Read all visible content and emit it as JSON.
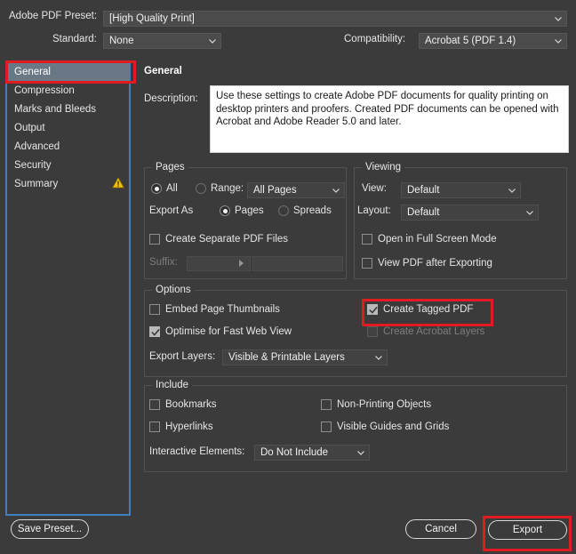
{
  "header": {
    "preset_label": "Adobe PDF Preset:",
    "preset_value": "[High Quality Print]",
    "standard_label": "Standard:",
    "standard_value": "None",
    "compatibility_label": "Compatibility:",
    "compatibility_value": "Acrobat 5 (PDF 1.4)"
  },
  "sidebar": {
    "items": [
      {
        "label": "General"
      },
      {
        "label": "Compression"
      },
      {
        "label": "Marks and Bleeds"
      },
      {
        "label": "Output"
      },
      {
        "label": "Advanced"
      },
      {
        "label": "Security"
      },
      {
        "label": "Summary"
      }
    ]
  },
  "main": {
    "title": "General",
    "description_label": "Description:",
    "description_value": "Use these settings to create Adobe PDF documents for quality printing on desktop printers and proofers.  Created PDF documents can be opened with Acrobat and Adobe Reader 5.0 and later.",
    "pages": {
      "legend": "Pages",
      "all_label": "All",
      "range_label": "Range:",
      "range_value": "All Pages",
      "export_as_label": "Export As",
      "pages_label": "Pages",
      "spreads_label": "Spreads",
      "create_separate_label": "Create Separate PDF Files",
      "suffix_label": "Suffix:"
    },
    "viewing": {
      "legend": "Viewing",
      "view_label": "View:",
      "view_value": "Default",
      "layout_label": "Layout:",
      "layout_value": "Default",
      "full_screen_label": "Open in Full Screen Mode",
      "view_pdf_label": "View PDF after Exporting"
    },
    "options": {
      "legend": "Options",
      "embed_thumbs_label": "Embed Page Thumbnails",
      "optimise_label": "Optimise for Fast Web View",
      "tagged_pdf_label": "Create Tagged PDF",
      "acrobat_layers_label": "Create Acrobat Layers",
      "export_layers_label": "Export Layers:",
      "export_layers_value": "Visible & Printable Layers"
    },
    "include": {
      "legend": "Include",
      "bookmarks_label": "Bookmarks",
      "hyperlinks_label": "Hyperlinks",
      "non_printing_label": "Non-Printing Objects",
      "visible_guides_label": "Visible Guides and Grids",
      "interactive_label": "Interactive Elements:",
      "interactive_value": "Do Not Include"
    }
  },
  "footer": {
    "save_preset_label": "Save Preset...",
    "cancel_label": "Cancel",
    "export_label": "Export"
  },
  "annotations": {
    "highlight_color": "#e01b22",
    "outline_color": "#3d7fc1"
  }
}
